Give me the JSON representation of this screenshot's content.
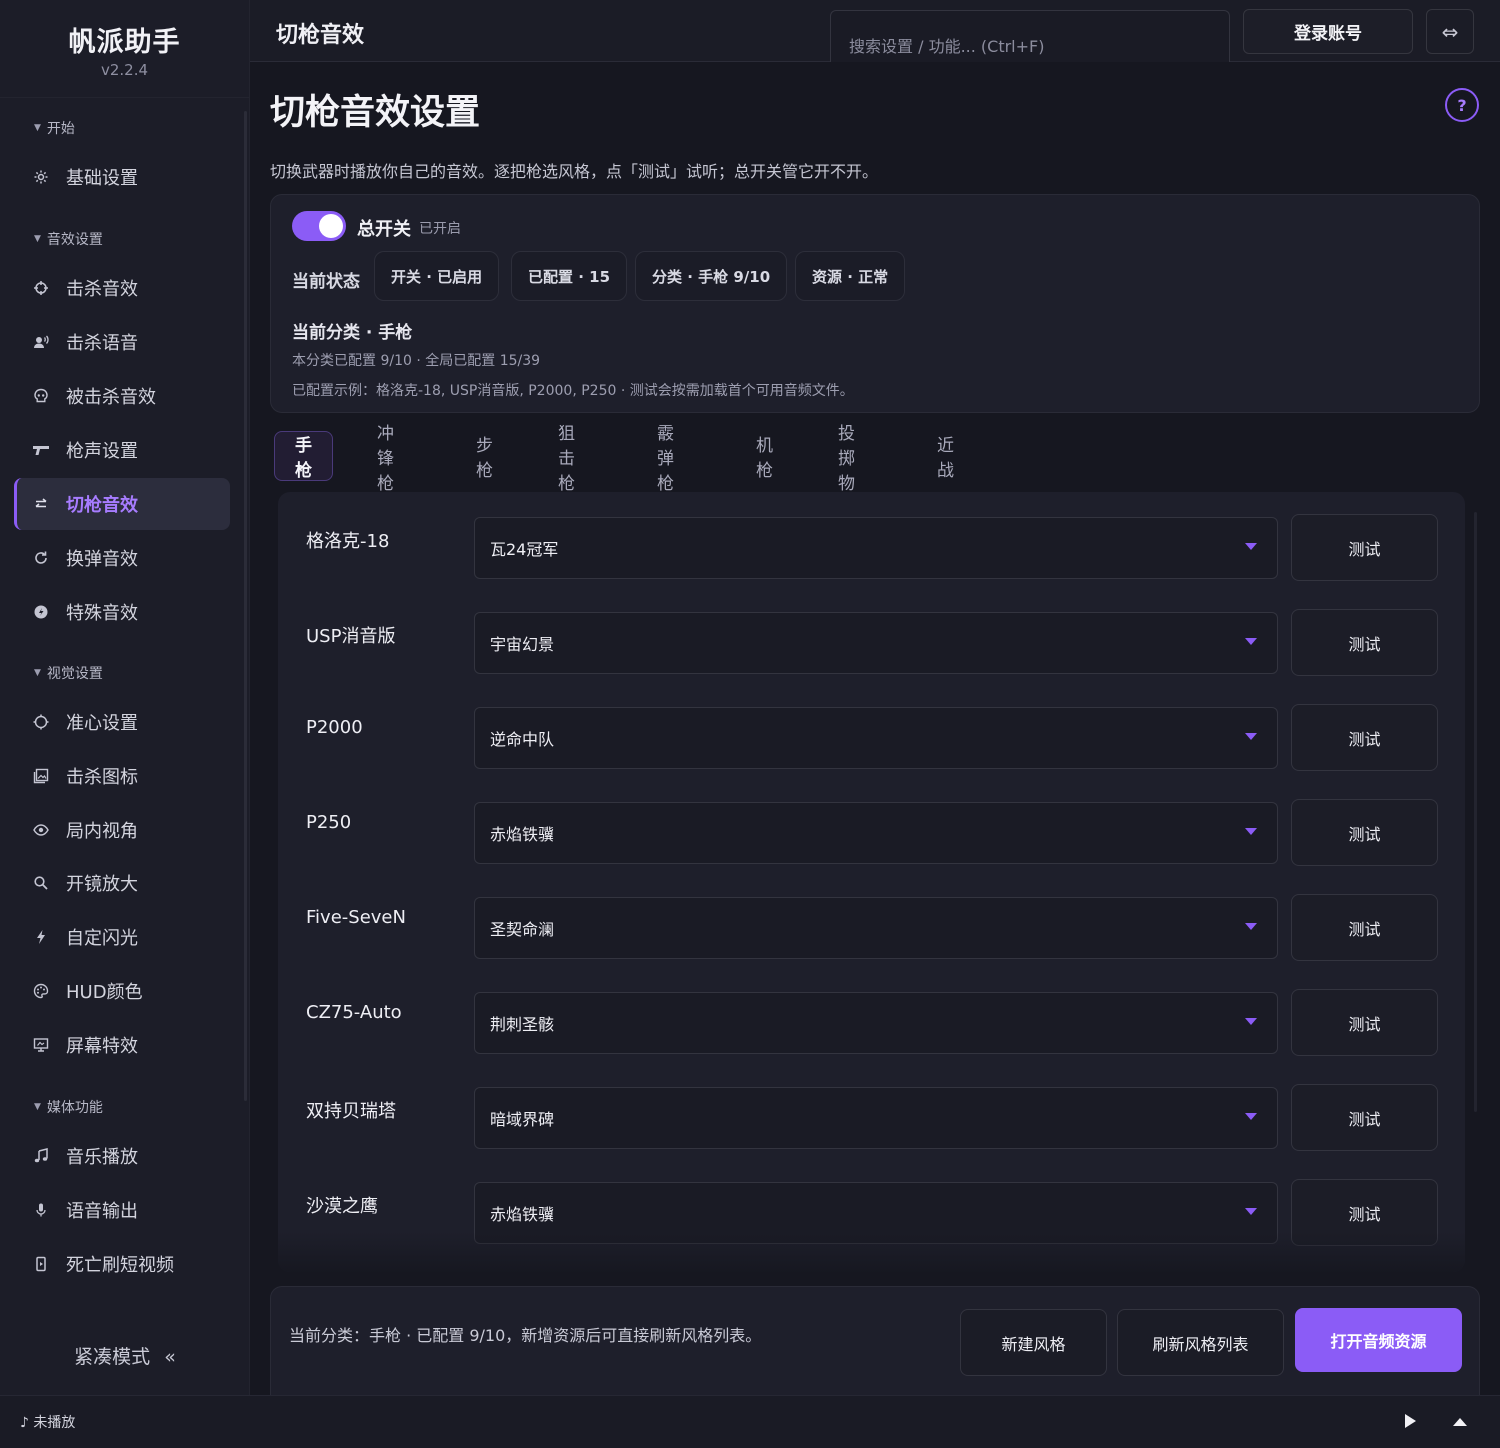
{
  "app": {
    "name": "帆派助手",
    "version": "v2.2.4"
  },
  "topbar": {
    "page_title": "切枪音效",
    "search_placeholder": "搜索设置 / 功能...  (Ctrl+F)",
    "login_label": "登录账号",
    "swap_glyph": "⇔"
  },
  "sidebar": {
    "groups": [
      {
        "label": "开始"
      },
      {
        "label": "音效设置"
      },
      {
        "label": "视觉设置"
      },
      {
        "label": "媒体功能"
      }
    ],
    "items": [
      {
        "label": "基础设置",
        "icon": "gear-icon"
      },
      {
        "label": "击杀音效",
        "icon": "crosshair-icon"
      },
      {
        "label": "击杀语音",
        "icon": "voice-icon"
      },
      {
        "label": "被击杀音效",
        "icon": "skull-icon"
      },
      {
        "label": "枪声设置",
        "icon": "gun-icon"
      },
      {
        "label": "切枪音效",
        "icon": "swap-icon",
        "active": true
      },
      {
        "label": "换弹音效",
        "icon": "reload-icon"
      },
      {
        "label": "特殊音效",
        "icon": "special-icon"
      },
      {
        "label": "准心设置",
        "icon": "reticle-icon"
      },
      {
        "label": "击杀图标",
        "icon": "image-icon"
      },
      {
        "label": "局内视角",
        "icon": "eye-icon"
      },
      {
        "label": "开镜放大",
        "icon": "zoom-icon"
      },
      {
        "label": "自定闪光",
        "icon": "flash-icon"
      },
      {
        "label": "HUD颜色",
        "icon": "palette-icon"
      },
      {
        "label": "屏幕特效",
        "icon": "monitor-icon"
      },
      {
        "label": "音乐播放",
        "icon": "music-icon"
      },
      {
        "label": "语音输出",
        "icon": "mic-icon"
      },
      {
        "label": "死亡刷短视频",
        "icon": "phone-icon"
      }
    ],
    "compact_label": "紧凑模式",
    "compact_glyph": "«"
  },
  "main": {
    "heading": "切枪音效设置",
    "help_glyph": "?",
    "description": "切换武器时播放你自己的音效。逐把枪选风格，点「测试」试听；总开关管它开不开。",
    "master": {
      "label": "总开关",
      "state_text": "已开启",
      "on": true
    },
    "current_state_label": "当前状态",
    "chips": [
      "开关 · 已启用",
      "已配置 · 15",
      "分类 · 手枪 9/10",
      "资源 · 正常"
    ],
    "category": {
      "title": "当前分类 · 手枪",
      "line1": "本分类已配置 9/10 · 全局已配置 15/39",
      "line2": "已配置示例：格洛克-18, USP消音版, P2000, P250 · 测试会按需加载首个可用音频文件。"
    },
    "tabs": [
      "手枪",
      "冲锋枪",
      "步枪",
      "狙击枪",
      "霰弹枪",
      "机枪",
      "投掷物",
      "近战"
    ],
    "active_tab": "手枪",
    "test_label": "测试",
    "weapons": [
      {
        "name": "格洛克-18",
        "style": "瓦24冠军"
      },
      {
        "name": "USP消音版",
        "style": "宇宙幻景"
      },
      {
        "name": "P2000",
        "style": "逆命中队"
      },
      {
        "name": "P250",
        "style": "赤焰铁骥"
      },
      {
        "name": "Five-SeveN",
        "style": "圣契命澜"
      },
      {
        "name": "CZ75-Auto",
        "style": "荆刺圣骸"
      },
      {
        "name": "双持贝瑞塔",
        "style": "暗域界碑"
      },
      {
        "name": "沙漠之鹰",
        "style": "赤焰铁骥"
      }
    ],
    "footer": {
      "text": "当前分类：手枪 · 已配置 9/10，新增资源后可直接刷新风格列表。",
      "new_style": "新建风格",
      "refresh_styles": "刷新风格列表",
      "open_resources": "打开音频资源"
    }
  },
  "player": {
    "now_playing": "♪ 未播放"
  },
  "colors": {
    "accent": "#8b5cf6",
    "accent_text": "#a77cff",
    "bg": "#161720",
    "panel": "#1e1f2b"
  }
}
